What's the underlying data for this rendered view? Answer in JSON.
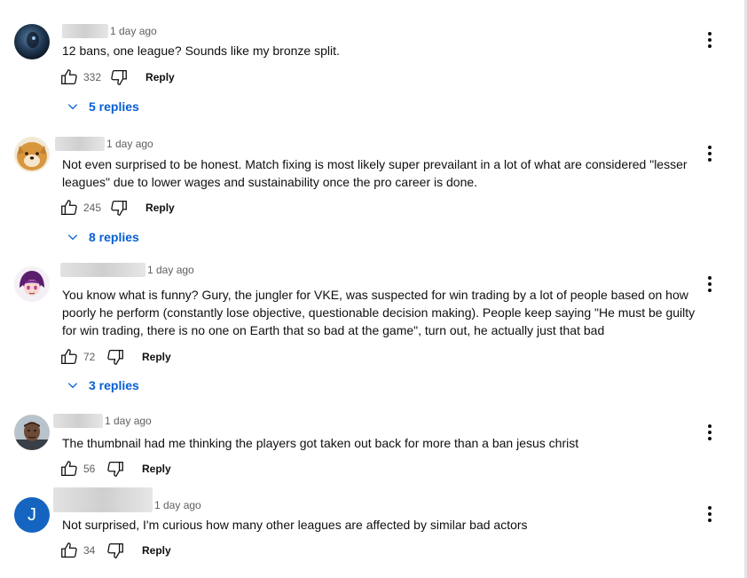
{
  "comments": [
    {
      "time": "1 day ago",
      "text": "12 bans, one league? Sounds like my bronze split.",
      "likes": "332",
      "reply_label": "Reply",
      "replies_label": "5 replies"
    },
    {
      "time": "1 day ago",
      "text": "Not even surprised to be honest. Match fixing is most likely super prevailant in a lot of what are considered \"lesser leagues\" due to lower wages and sustainability once the pro career is done.",
      "likes": "245",
      "reply_label": "Reply",
      "replies_label": "8 replies"
    },
    {
      "time": "1 day ago",
      "text": "You know what is funny? Gury, the jungler for VKE, was suspected for win trading by a lot of people based on how poorly he perform (constantly lose objective, questionable decision making). People keep saying \"He must be guilty for win trading, there is no one on Earth that so bad at the game\", turn out, he actually just that bad",
      "likes": "72",
      "reply_label": "Reply",
      "replies_label": "3 replies"
    },
    {
      "time": "1 day ago",
      "text": "The thumbnail had me thinking the players got taken out back for more than a ban jesus christ",
      "likes": "56",
      "reply_label": "Reply"
    },
    {
      "time": "1 day ago",
      "text": "Not surprised, I'm curious how many other leagues are affected by similar bad actors",
      "likes": "34",
      "reply_label": "Reply",
      "avatar_letter": "J"
    }
  ],
  "colors": {
    "link_blue": "#065fd4",
    "secondary_text": "#606060",
    "avatar_j": "#1565c0"
  },
  "icons": [
    "like-icon",
    "dislike-icon",
    "chevron-down-icon",
    "more-vert-icon"
  ]
}
